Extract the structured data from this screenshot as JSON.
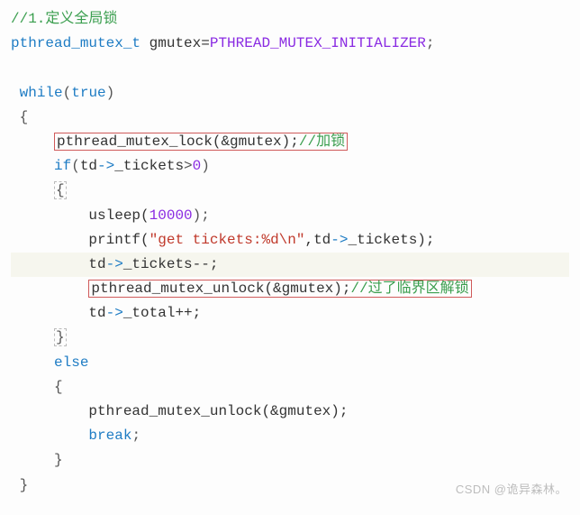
{
  "lines": {
    "l1_comment": "//1.定义全局锁",
    "l2_type": "pthread_mutex_t",
    "l2_var": " gmutex=",
    "l2_const": "PTHREAD_MUTEX_INITIALIZER",
    "l2_end": ";",
    "l4_while": "while",
    "l4_paren_o": "(",
    "l4_true": "true",
    "l4_paren_c": ")",
    "l5_brace": "{",
    "l6_lock": "pthread_mutex_lock(&gmutex);",
    "l6_comment": "//加锁",
    "l7_if": "if",
    "l7_paren_o": "(",
    "l7_td": "td",
    "l7_arrow": "->",
    "l7_tickets": "_tickets",
    "l7_gt": ">",
    "l7_zero": "0",
    "l7_paren_c": ")",
    "l8_brace": "{",
    "l9_usleep": "usleep(",
    "l9_num": "10000",
    "l9_end": ");",
    "l10_printf": "printf(",
    "l10_str": "\"get tickets:%d\\n\"",
    "l10_mid": ",td",
    "l10_arrow": "->",
    "l10_tickets": "_tickets);",
    "l11_td": "td",
    "l11_arrow": "->",
    "l11_rest": "_tickets--;",
    "l12_unlock": "pthread_mutex_unlock(&gmutex);",
    "l12_comment": "//过了临界区解锁",
    "l13_td": "td",
    "l13_arrow": "->",
    "l13_rest": "_total++;",
    "l14_brace": "}",
    "l15_else": "else",
    "l16_brace": "{",
    "l17_unlock": "pthread_mutex_unlock(&gmutex);",
    "l18_break": "break",
    "l18_semi": ";",
    "l19_brace": "}",
    "l20_brace": "}"
  },
  "watermark": "CSDN @诡异森林。"
}
